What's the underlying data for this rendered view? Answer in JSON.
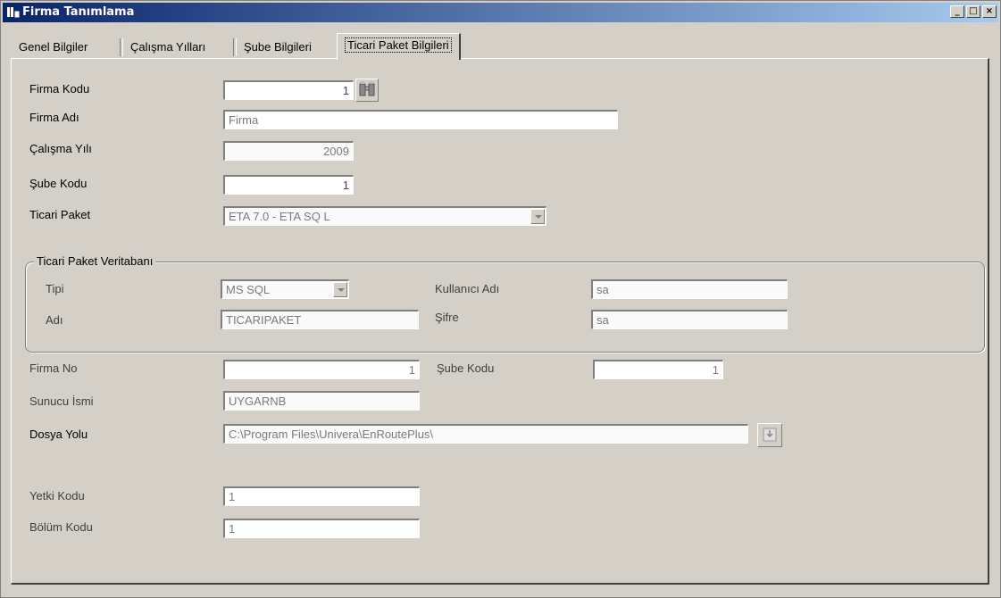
{
  "window": {
    "title": "Firma Tanımlama",
    "buttons": {
      "minimize": "_",
      "maximize": "□",
      "close": "×"
    }
  },
  "tabs": [
    {
      "label": "Genel Bilgiler"
    },
    {
      "label": "Çalışma Yılları"
    },
    {
      "label": "Şube Bilgileri"
    },
    {
      "label": "Ticari Paket Bilgileri"
    }
  ],
  "form": {
    "firma_kodu": {
      "label": "Firma Kodu",
      "value": "1"
    },
    "firma_adi": {
      "label": "Firma Adı",
      "value": "Firma"
    },
    "calisma_yili": {
      "label": "Çalışma Yılı",
      "value": "2009"
    },
    "sube_kodu": {
      "label": "Şube Kodu",
      "value": "1"
    },
    "ticari_paket": {
      "label": "Ticari Paket",
      "value": "ETA 7.0 - ETA SQ L"
    }
  },
  "veritabani": {
    "title": "Ticari Paket Veritabanı",
    "tipi": {
      "label": "Tipi",
      "value": "MS SQL"
    },
    "adi": {
      "label": "Adı",
      "value": "TICARIPAKET"
    },
    "kullanici_adi": {
      "label": "Kullanıcı Adı",
      "value": "sa"
    },
    "sifre": {
      "label": "Şifre",
      "value": "sa"
    }
  },
  "paket": {
    "firma_no": {
      "label": "Firma No",
      "value": "1"
    },
    "sube_kodu": {
      "label": "Şube Kodu",
      "value": "1"
    },
    "sunucu": {
      "label": "Sunucu İsmi",
      "value": "UYGARNB"
    },
    "dosya_yolu": {
      "label": "Dosya Yolu",
      "value": "C:\\Program Files\\Univera\\EnRoutePlus\\"
    },
    "yetki_kodu": {
      "label": "Yetki Kodu",
      "value": "1"
    },
    "bolum_kodu": {
      "label": "Bölüm Kodu",
      "value": "1"
    }
  }
}
